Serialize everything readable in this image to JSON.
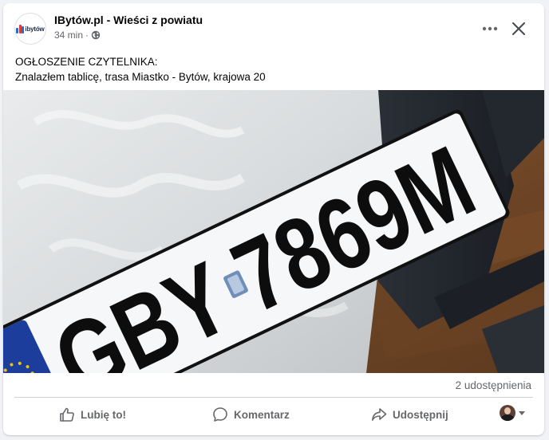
{
  "header": {
    "page_name": "IBytów.pl - Wieści z powiatu",
    "timestamp": "34 min",
    "separator": "·",
    "avatar_logo_text": "ibytów",
    "privacy_icon": "globe-icon",
    "more_icon": "more-horizontal-icon",
    "close_icon": "close-icon"
  },
  "post": {
    "line1": "OGŁOSZENIE CZYTELNIKA:",
    "line2": "Znalazłem tablicę, trasa Miastko - Bytów, krajowa 20"
  },
  "photo": {
    "plate_text": "GBY 7869M"
  },
  "stats": {
    "shares": "2 udostępnienia"
  },
  "actions": {
    "like": "Lubię to!",
    "comment": "Komentarz",
    "share": "Udostępnij"
  },
  "colors": {
    "brand_blue": "#1f6fd1",
    "secondary_text": "#65676b",
    "eu_blue": "#1d3d9c"
  }
}
